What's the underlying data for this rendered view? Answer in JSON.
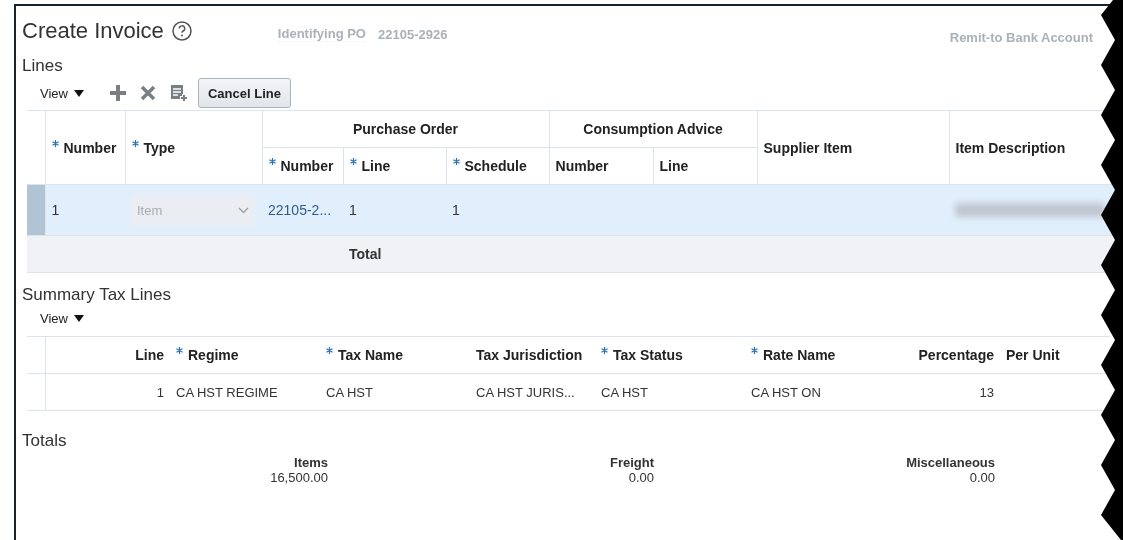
{
  "page": {
    "title": "Create Invoice",
    "identifying_po": {
      "label": "Identifying PO",
      "value": "22105-2926"
    },
    "remit_to": {
      "label": "Remit-to Bank Account"
    }
  },
  "lines": {
    "title": "Lines",
    "toolbar": {
      "view": "View",
      "cancel_button": "Cancel Line"
    },
    "columns": [
      {
        "label": "Number",
        "required": true
      },
      {
        "label": "Type",
        "required": true
      },
      {
        "group": "Purchase Order",
        "children": [
          {
            "label": "Number",
            "required": true
          },
          {
            "label": "Line",
            "required": true
          },
          {
            "label": "Schedule",
            "required": true
          }
        ]
      },
      {
        "group": "Consumption Advice",
        "children": [
          {
            "label": "Number",
            "required": false
          },
          {
            "label": "Line",
            "required": false
          }
        ]
      },
      {
        "label": "Supplier Item",
        "required": false
      },
      {
        "label": "Item Description",
        "required": false
      }
    ],
    "rows": [
      {
        "selected": true,
        "number": "1",
        "type": {
          "value": "Item",
          "disabled": true
        },
        "po_number": "22105-2...",
        "po_line": "1",
        "po_schedule": "1",
        "item_description": {
          "redacted": true
        }
      }
    ],
    "total_label": "Total"
  },
  "summary_tax_lines": {
    "title": "Summary Tax Lines",
    "view": "View",
    "columns": [
      {
        "label": "Line",
        "required": false,
        "numeric": true
      },
      {
        "label": "Regime",
        "required": true,
        "numeric": false
      },
      {
        "label": "Tax Name",
        "required": true,
        "numeric": false
      },
      {
        "label": "Tax Jurisdiction",
        "required": false,
        "numeric": false
      },
      {
        "label": "Tax Status",
        "required": true,
        "numeric": false
      },
      {
        "label": "Rate Name",
        "required": true,
        "numeric": false
      },
      {
        "label": "Percentage",
        "required": false,
        "numeric": true
      },
      {
        "label": "Per Unit",
        "required": false,
        "numeric": false
      }
    ],
    "rows": [
      {
        "selected": false,
        "cells": [
          "1",
          "CA HST REGIME",
          "CA HST",
          "CA HST JURIS...",
          "CA HST",
          "CA HST ON",
          "13"
        ]
      }
    ]
  },
  "totals": {
    "title": "Totals",
    "items": [
      {
        "label": "Items",
        "value": "16,500.00"
      },
      {
        "label": "Freight",
        "value": "0.00"
      },
      {
        "label": "Miscellaneous",
        "value": "0.00"
      }
    ]
  }
}
